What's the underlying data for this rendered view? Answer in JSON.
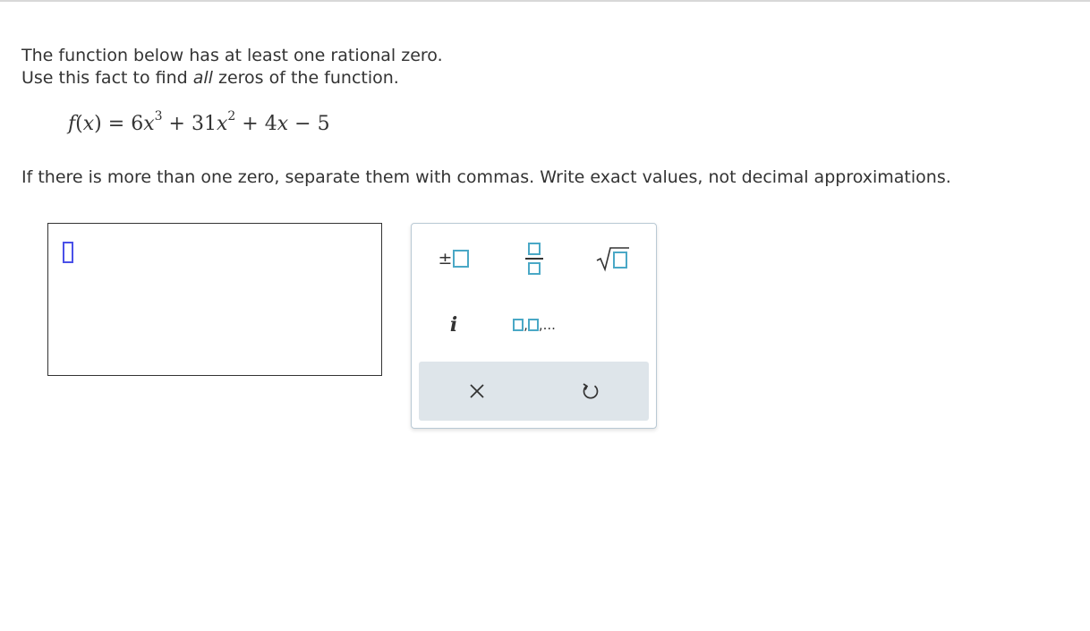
{
  "question": {
    "line1": "The function below has at least one rational zero.",
    "line2_before": "Use this fact to find ",
    "line2_emph": "all",
    "line2_after": " zeros of the function.",
    "equation": {
      "fx": "f",
      "paren_open": "(",
      "var": "x",
      "paren_close": ")",
      "equals": " = ",
      "coef1": "6",
      "var1": "x",
      "exp1": "3",
      "op1": " + ",
      "coef2": "31",
      "var2": "x",
      "exp2": "2",
      "op2": " + ",
      "coef3": "4",
      "var3": "x",
      "op3": " − ",
      "const": "5"
    },
    "instructions": "If there is more than one zero, separate them with commas. Write exact values, not decimal approximations."
  },
  "palette": {
    "plus_minus": "±",
    "imaginary": "i",
    "list": ",...",
    "list_sep": ","
  },
  "colors": {
    "caret": "#4a50e8",
    "template_box": "#4aa8c6",
    "action_bar": "#dee5ea"
  }
}
